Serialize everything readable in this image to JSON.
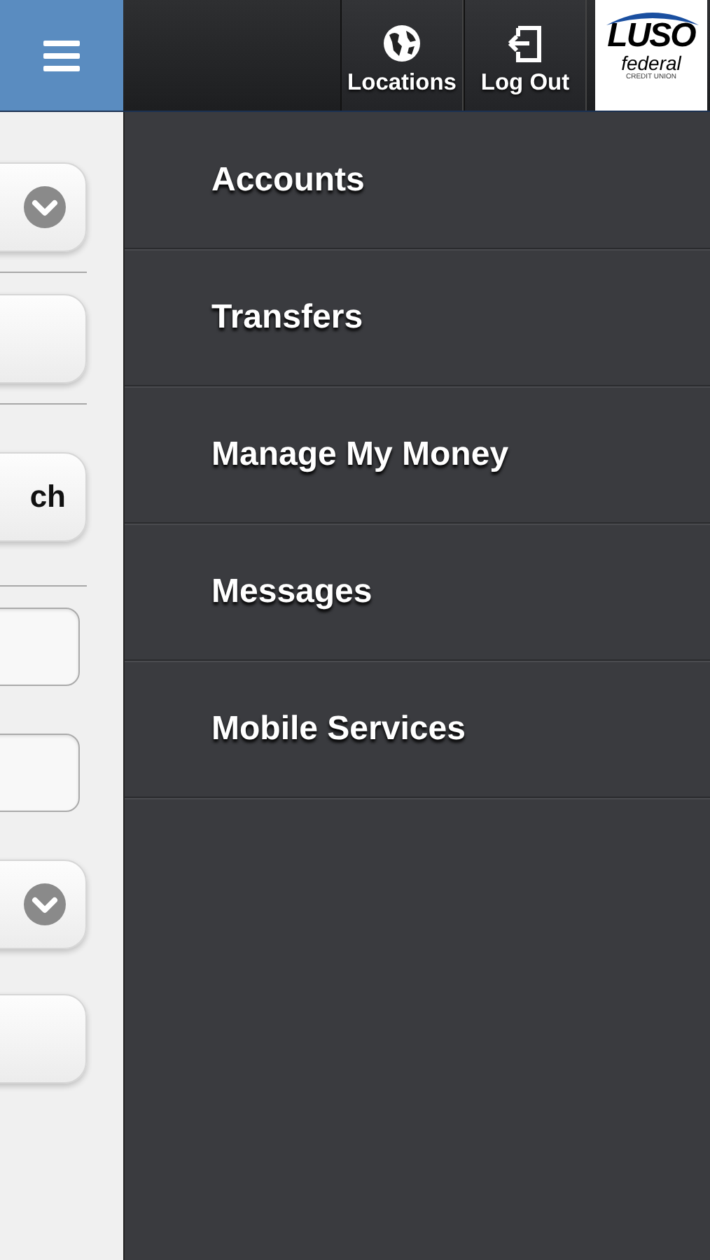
{
  "header": {
    "actions": [
      {
        "label": "Locations",
        "kind": "locations"
      },
      {
        "label": "Log Out",
        "kind": "logout"
      }
    ],
    "logo": {
      "name": "LUSO",
      "sub": "federal",
      "tag": "CREDIT UNION"
    }
  },
  "background_form": {
    "controls": [
      {
        "kind": "select"
      },
      {
        "kind": "divider"
      },
      {
        "kind": "button"
      },
      {
        "kind": "divider"
      },
      {
        "kind": "button",
        "label": "ch"
      },
      {
        "kind": "divider"
      },
      {
        "kind": "input"
      },
      {
        "kind": "input"
      },
      {
        "kind": "select"
      },
      {
        "kind": "button"
      }
    ]
  },
  "menu": {
    "items": [
      {
        "label": "Accounts"
      },
      {
        "label": "Transfers"
      },
      {
        "label": "Manage My Money"
      },
      {
        "label": "Messages"
      },
      {
        "label": "Mobile Services"
      }
    ]
  }
}
